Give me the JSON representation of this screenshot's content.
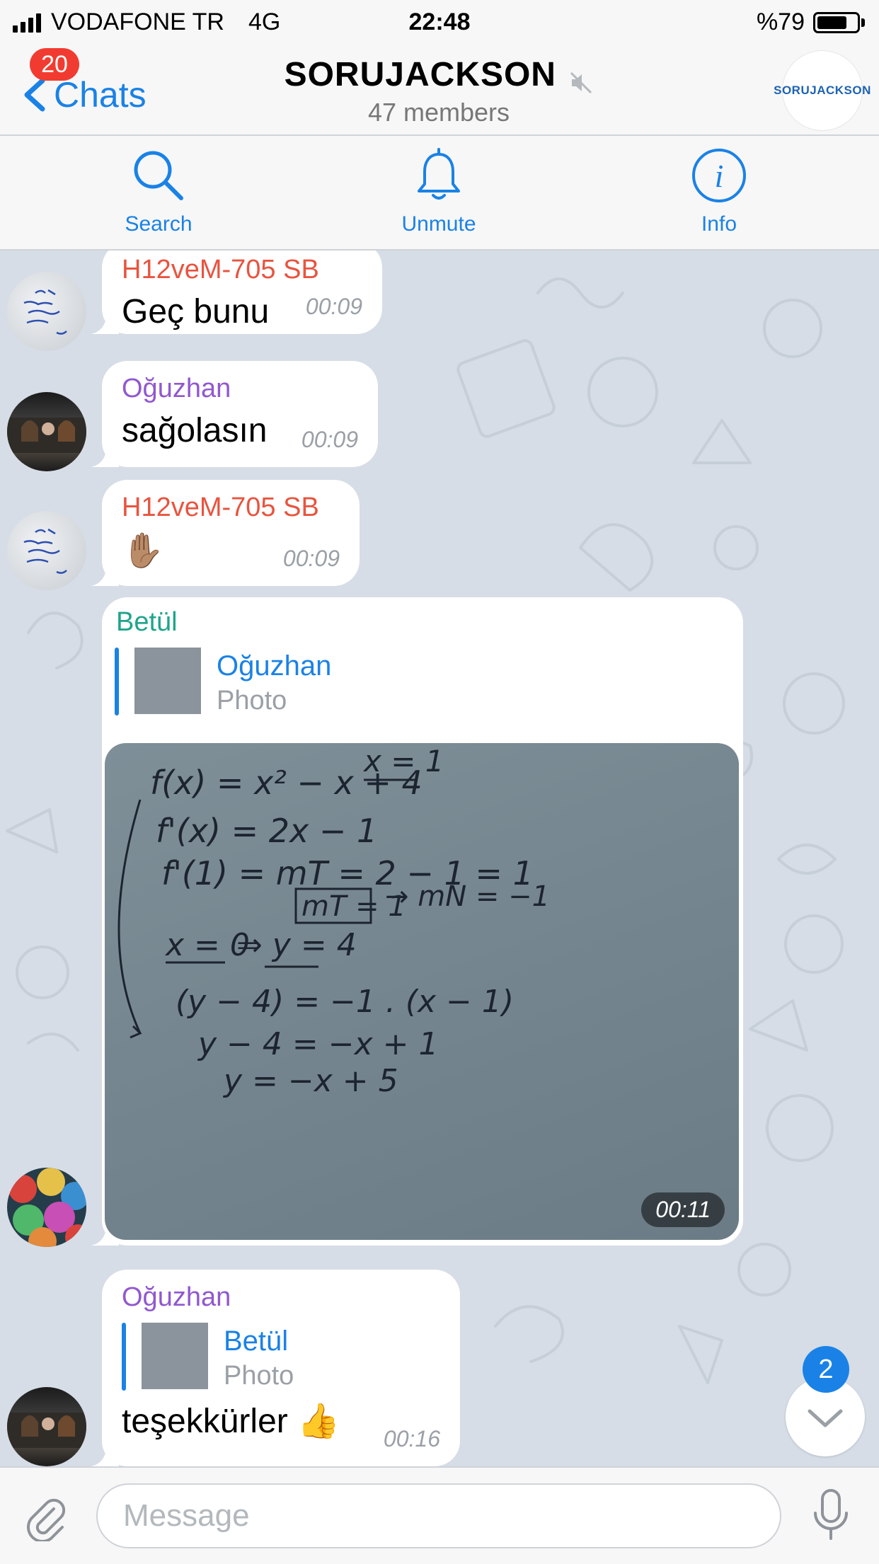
{
  "status_bar": {
    "carrier": "VODAFONE TR",
    "network": "4G",
    "time": "22:48",
    "battery": "%79",
    "battery_level": 0.79
  },
  "nav": {
    "back_label": "Chats",
    "unread_count": "20",
    "title": "SORUJACKSON",
    "subtitle": "47 members",
    "group_logo": "SORUJACKSON",
    "muted": true
  },
  "actions": {
    "search": "Search",
    "unmute": "Unmute",
    "info": "Info"
  },
  "messages": [
    {
      "sender": "H12veM-705 SB",
      "text": "Geç bunu",
      "time": "00:09"
    },
    {
      "sender": "Oğuzhan",
      "text": "sağolasın",
      "time": "00:09"
    },
    {
      "sender": "H12veM-705 SB",
      "text": "✋🏽",
      "time": "00:09"
    },
    {
      "sender": "Betül",
      "reply_to": "Oğuzhan",
      "reply_type": "Photo",
      "time": "00:11",
      "photo_lines": [
        "f(x) = x² − x + 4",
        "x = 1",
        "f'(x) = 2x − 1",
        "f'(1) = mT = 2 − 1 = 1",
        "mT = 1",
        "→ mN = −1",
        "x = 0",
        "⇒ y = 4",
        "(y − 4) = −1 . (x − 1)",
        "y − 4 = −x + 1",
        "y = −x + 5"
      ]
    },
    {
      "sender": "Oğuzhan",
      "reply_to": "Betül",
      "reply_type": "Photo",
      "text": "teşekkürler 👍",
      "time": "00:16"
    }
  ],
  "scroll_badge": "2",
  "input": {
    "placeholder": "Message"
  },
  "colors": {
    "accent": "#1a82e6",
    "badge_red": "#f23b30",
    "sender_red": "#e8543f",
    "sender_purple": "#9158cf",
    "sender_green": "#1fa58a",
    "wallpaper": "#d6dde6"
  }
}
